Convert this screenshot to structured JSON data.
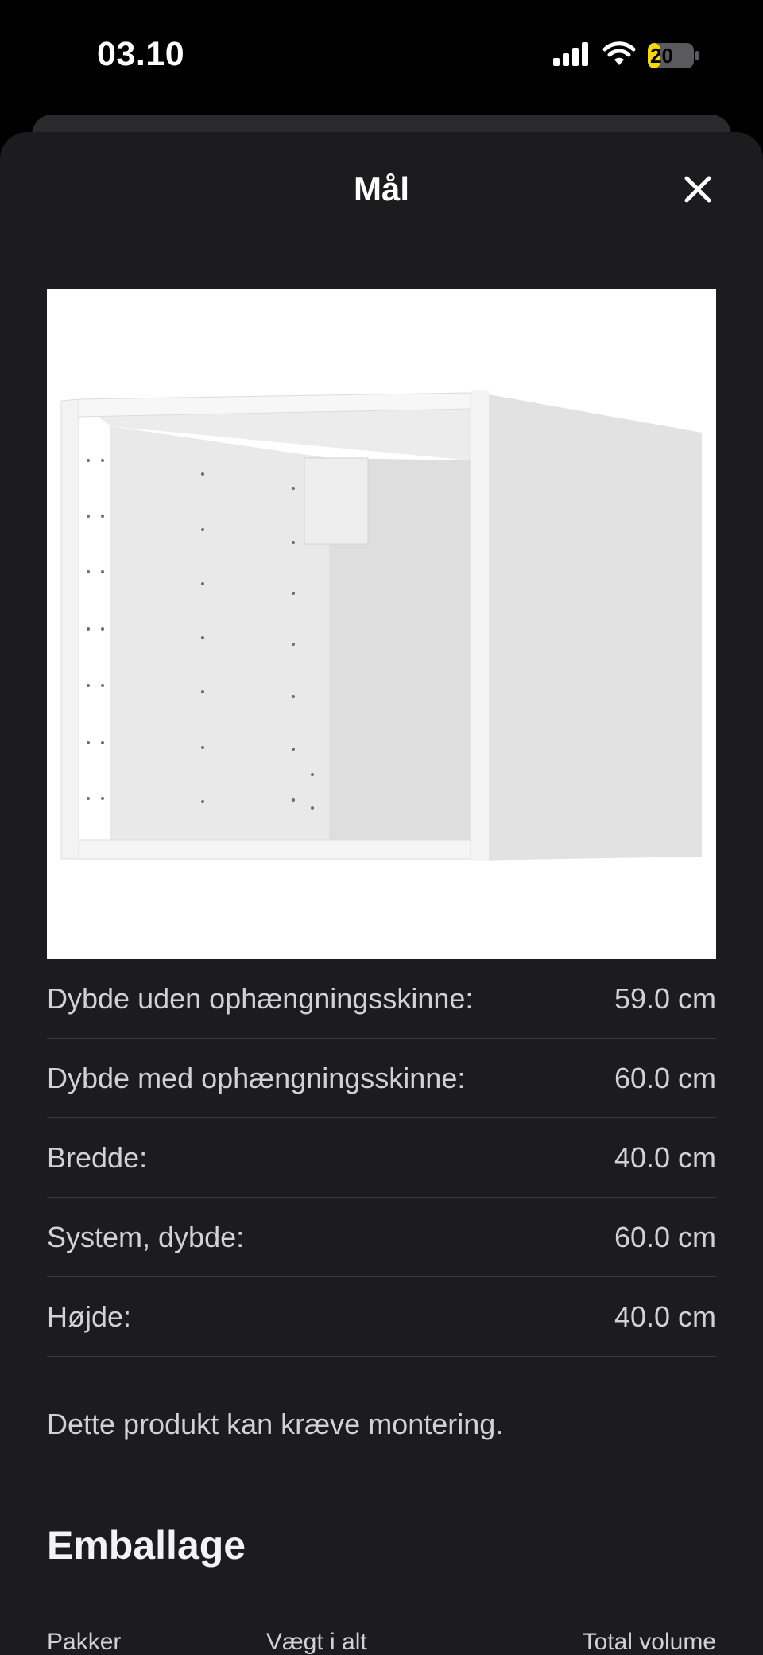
{
  "status_bar": {
    "time": "03.10",
    "battery": "20"
  },
  "sheet": {
    "title": "Mål"
  },
  "specs": [
    {
      "label": "Dybde uden ophængningsskinne:",
      "value": "59.0 cm"
    },
    {
      "label": "Dybde med ophængningsskinne:",
      "value": "60.0 cm"
    },
    {
      "label": "Bredde:",
      "value": "40.0 cm"
    },
    {
      "label": "System, dybde:",
      "value": "60.0 cm"
    },
    {
      "label": "Højde:",
      "value": "40.0 cm"
    }
  ],
  "note": "Dette produkt kan kræve montering.",
  "packaging": {
    "title": "Emballage",
    "columns": [
      "Pakker",
      "Vægt i alt",
      "Total volume"
    ]
  },
  "colors": {
    "sheet_bg": "#1c1c1e",
    "divider": "#3a3a3c",
    "battery_accent": "#f5d90a"
  },
  "icons": [
    "signal-icon",
    "wifi-icon",
    "battery-icon",
    "close-icon"
  ]
}
